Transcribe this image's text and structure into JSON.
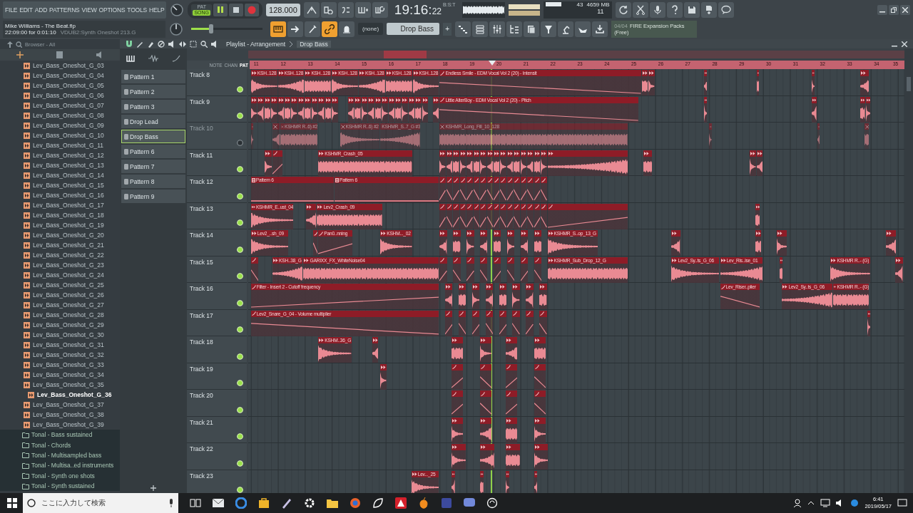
{
  "menu": [
    "FILE",
    "EDIT",
    "ADD",
    "PATTERNS",
    "VIEW",
    "OPTIONS",
    "TOOLS",
    "HELP"
  ],
  "transport": {
    "pat": "PAT",
    "song": "SONG",
    "song_mode": true,
    "playing": true,
    "tempo": "128.000"
  },
  "clock": {
    "main": "19:16:",
    "small": "22",
    "unit": "B:S:T"
  },
  "monitor": {
    "cpu": "43",
    "memory": "4659 MB",
    "polyphony": "11"
  },
  "hint": {
    "title": "Mike Williams - The Beat.flp",
    "detail": "22:09:00 for 0:01:10",
    "sample": "VDUB2:Synth Oneshot 213.G"
  },
  "master_pitch": {
    "level": 0.28
  },
  "tool_toggles": [
    {
      "on": true
    },
    {
      "on": false
    },
    {
      "on": false
    },
    {
      "on": true
    },
    {
      "on": false
    }
  ],
  "pattern_selector": {
    "none": "(none)",
    "current": "Drop Bass",
    "add": "+"
  },
  "news": {
    "count": "04/04",
    "title": "FIRE Expansion Packs",
    "subtitle": "(Free)"
  },
  "browser": {
    "title": "Browser - All",
    "items": [
      {
        "label": "Lev_Bass_Oneshot_G_03",
        "kind": "file",
        "selected": false
      },
      {
        "label": "Lev_Bass_Oneshot_G_04",
        "kind": "file",
        "selected": false
      },
      {
        "label": "Lev_Bass_Oneshot_G_05",
        "kind": "file",
        "selected": false
      },
      {
        "label": "Lev_Bass_Oneshot_G_06",
        "kind": "file",
        "selected": false
      },
      {
        "label": "Lev_Bass_Oneshot_G_07",
        "kind": "file",
        "selected": false
      },
      {
        "label": "Lev_Bass_Oneshot_G_08",
        "kind": "file",
        "selected": false
      },
      {
        "label": "Lev_Bass_Oneshot_G_09",
        "kind": "file",
        "selected": false
      },
      {
        "label": "Lev_Bass_Oneshot_G_10",
        "kind": "file",
        "selected": false
      },
      {
        "label": "Lev_Bass_Oneshot_G_11",
        "kind": "file",
        "selected": false
      },
      {
        "label": "Lev_Bass_Oneshot_G_12",
        "kind": "file",
        "selected": false
      },
      {
        "label": "Lev_Bass_Oneshot_G_13",
        "kind": "file",
        "selected": false
      },
      {
        "label": "Lev_Bass_Oneshot_G_14",
        "kind": "file",
        "selected": false
      },
      {
        "label": "Lev_Bass_Oneshot_G_15",
        "kind": "file",
        "selected": false
      },
      {
        "label": "Lev_Bass_Oneshot_G_16",
        "kind": "file",
        "selected": false
      },
      {
        "label": "Lev_Bass_Oneshot_G_17",
        "kind": "file",
        "selected": false
      },
      {
        "label": "Lev_Bass_Oneshot_G_18",
        "kind": "file",
        "selected": false
      },
      {
        "label": "Lev_Bass_Oneshot_G_19",
        "kind": "file",
        "selected": false
      },
      {
        "label": "Lev_Bass_Oneshot_G_20",
        "kind": "file",
        "selected": false
      },
      {
        "label": "Lev_Bass_Oneshot_G_21",
        "kind": "file",
        "selected": false
      },
      {
        "label": "Lev_Bass_Oneshot_G_22",
        "kind": "file",
        "selected": false
      },
      {
        "label": "Lev_Bass_Oneshot_G_23",
        "kind": "file",
        "selected": false
      },
      {
        "label": "Lev_Bass_Oneshot_G_24",
        "kind": "file",
        "selected": false
      },
      {
        "label": "Lev_Bass_Oneshot_G_25",
        "kind": "file",
        "selected": false
      },
      {
        "label": "Lev_Bass_Oneshot_G_26",
        "kind": "file",
        "selected": false
      },
      {
        "label": "Lev_Bass_Oneshot_G_27",
        "kind": "file",
        "selected": false
      },
      {
        "label": "Lev_Bass_Oneshot_G_28",
        "kind": "file",
        "selected": false
      },
      {
        "label": "Lev_Bass_Oneshot_G_29",
        "kind": "file",
        "selected": false
      },
      {
        "label": "Lev_Bass_Oneshot_G_30",
        "kind": "file",
        "selected": false
      },
      {
        "label": "Lev_Bass_Oneshot_G_31",
        "kind": "file",
        "selected": false
      },
      {
        "label": "Lev_Bass_Oneshot_G_32",
        "kind": "file",
        "selected": false
      },
      {
        "label": "Lev_Bass_Oneshot_G_33",
        "kind": "file",
        "selected": false
      },
      {
        "label": "Lev_Bass_Oneshot_G_34",
        "kind": "file",
        "selected": false
      },
      {
        "label": "Lev_Bass_Oneshot_G_35",
        "kind": "file",
        "selected": false
      },
      {
        "label": "Lev_Bass_Oneshot_G_36",
        "kind": "file",
        "selected": true
      },
      {
        "label": "Lev_Bass_Oneshot_G_37",
        "kind": "file",
        "selected": false
      },
      {
        "label": "Lev_Bass_Oneshot_G_38",
        "kind": "file",
        "selected": false
      },
      {
        "label": "Lev_Bass_Oneshot_G_39",
        "kind": "file",
        "selected": false
      },
      {
        "label": "Tonal - Bass sustained",
        "kind": "folder",
        "selected": false
      },
      {
        "label": "Tonal - Chords",
        "kind": "folder",
        "selected": false
      },
      {
        "label": "Tonal - Multisampled bass",
        "kind": "folder",
        "selected": false
      },
      {
        "label": "Tonal - Multisa..ed instruments",
        "kind": "folder",
        "selected": false
      },
      {
        "label": "Tonal - Synth one shots",
        "kind": "folder",
        "selected": false
      },
      {
        "label": "Tonal - Synth sustained",
        "kind": "folder",
        "selected": false
      }
    ]
  },
  "playlist": {
    "title": "Playlist - Arrangement",
    "breadcrumb": "Drop Bass",
    "patterns": [
      {
        "label": "Pattern 1",
        "selected": false
      },
      {
        "label": "Pattern 2",
        "selected": false
      },
      {
        "label": "Pattern 3",
        "selected": false
      },
      {
        "label": "Drop Lead",
        "selected": false
      },
      {
        "label": "Drop Bass",
        "selected": true
      },
      {
        "label": "Pattern 6",
        "selected": false
      },
      {
        "label": "Pattern 7",
        "selected": false
      },
      {
        "label": "Pattern 8",
        "selected": false
      },
      {
        "label": "Pattern 9",
        "selected": false
      }
    ],
    "ruler_modes": [
      {
        "label": "NOTE",
        "selected": false
      },
      {
        "label": "CHAN",
        "selected": false
      },
      {
        "label": "PAT",
        "selected": true
      }
    ],
    "ruler": [
      "11",
      "12",
      "13",
      "14",
      "15",
      "16",
      "17",
      "18",
      "19",
      "20",
      "21",
      "22",
      "23",
      "24",
      "25",
      "26",
      "27",
      "28",
      "29",
      "30",
      "31",
      "32",
      "33",
      "34",
      "35"
    ],
    "tracks": [
      {
        "name": "Track 8",
        "muted": false,
        "clips": [
          {
            "kind": "audio",
            "label": "KSH..128"
          },
          {
            "kind": "audio",
            "label": "KSH..128"
          },
          {
            "kind": "audio",
            "label": "KSH..128"
          },
          {
            "kind": "audio",
            "label": "KSH..128"
          },
          {
            "kind": "audio",
            "label": "KSH..128"
          },
          {
            "kind": "audio",
            "label": "KSH..128"
          },
          {
            "kind": "audio",
            "label": "KSH..128"
          },
          {
            "kind": "automation",
            "label": "Endless Smile - EDM Vocal Vol 2 (20) - Intensit"
          },
          {
            "kind": "audio"
          },
          {
            "kind": "audio"
          },
          {
            "kind": "audio"
          },
          {
            "kind": "audio"
          },
          {
            "kind": "audio"
          },
          {
            "kind": "audio"
          }
        ]
      },
      {
        "name": "Track 9",
        "muted": false,
        "clips": [
          {
            "kind": "audio"
          },
          {
            "kind": "audio"
          },
          {
            "kind": "audio"
          },
          {
            "kind": "audio"
          },
          {
            "kind": "audio"
          },
          {
            "kind": "audio"
          },
          {
            "kind": "audio"
          },
          {
            "kind": "audio"
          },
          {
            "kind": "audio"
          },
          {
            "kind": "audio"
          },
          {
            "kind": "audio"
          },
          {
            "kind": "audio"
          },
          {
            "kind": "audio"
          },
          {
            "kind": "audio"
          },
          {
            "kind": "audio"
          },
          {
            "kind": "audio"
          },
          {
            "kind": "audio"
          },
          {
            "kind": "audio"
          },
          {
            "kind": "audio"
          },
          {
            "kind": "audio"
          },
          {
            "kind": "audio"
          },
          {
            "kind": "audio"
          },
          {
            "kind": "audio"
          },
          {
            "kind": "audio"
          },
          {
            "kind": "audio"
          },
          {
            "kind": "audio"
          },
          {
            "kind": "automation",
            "label": "Little AlterBoy - EDM Vocal Vol 2 (20) - Pitch"
          },
          {
            "kind": "audio"
          },
          {
            "kind": "audio"
          },
          {
            "kind": "audio"
          },
          {
            "kind": "audio"
          }
        ]
      },
      {
        "name": "Track 10",
        "muted": true,
        "clips": [
          {
            "kind": "sliced"
          },
          {
            "kind": "sliced"
          },
          {
            "kind": "sliced",
            "label": "KSHMR R..6) #2"
          },
          {
            "kind": "sliced",
            "label": "KSHMR R..6) #2"
          },
          {
            "kind": "sliced",
            "label": "KSHMR_S..7_G #3"
          },
          {
            "kind": "sliced",
            "label": "KSHMR_Long_Fill_10_128"
          },
          {
            "kind": "sliced"
          },
          {
            "kind": "sliced"
          },
          {
            "kind": "sliced"
          }
        ]
      },
      {
        "name": "Track 11",
        "muted": false,
        "clips": [
          {
            "kind": "audio"
          },
          {
            "kind": "automation"
          },
          {
            "kind": "audio",
            "label": "KSHMR_Crash_05"
          },
          {
            "kind": "audio"
          },
          {
            "kind": "audio"
          },
          {
            "kind": "audio"
          },
          {
            "kind": "audio"
          },
          {
            "kind": "audio"
          },
          {
            "kind": "audio"
          },
          {
            "kind": "audio"
          },
          {
            "kind": "audio"
          },
          {
            "kind": "audio"
          },
          {
            "kind": "audio"
          },
          {
            "kind": "audio"
          },
          {
            "kind": "audio"
          },
          {
            "kind": "audio"
          },
          {
            "kind": "audio"
          },
          {
            "kind": "audio"
          },
          {
            "kind": "audio"
          },
          {
            "kind": "audio"
          },
          {
            "kind": "audio"
          },
          {
            "kind": "audio"
          },
          {
            "kind": "audio"
          }
        ]
      },
      {
        "name": "Track 12",
        "muted": false,
        "clips": [
          {
            "kind": "pattern",
            "label": "Pattern 6"
          },
          {
            "kind": "pattern",
            "label": "Pattern 6"
          },
          {
            "kind": "automation"
          },
          {
            "kind": "automation"
          },
          {
            "kind": "automation"
          },
          {
            "kind": "automation"
          },
          {
            "kind": "automation"
          },
          {
            "kind": "automation"
          },
          {
            "kind": "automation"
          },
          {
            "kind": "automation"
          },
          {
            "kind": "automation"
          },
          {
            "kind": "automation"
          },
          {
            "kind": "automation"
          },
          {
            "kind": "automation"
          },
          {
            "kind": "automation"
          },
          {
            "kind": "automation"
          },
          {
            "kind": "automation"
          },
          {
            "kind": "automation"
          }
        ]
      },
      {
        "name": "Track 13",
        "muted": false,
        "clips": [
          {
            "kind": "audio",
            "label": "KSHMR_E..ust_04"
          },
          {
            "kind": "audio"
          },
          {
            "kind": "audio",
            "label": "Lev2_Crash_09"
          },
          {
            "kind": "automation"
          },
          {
            "kind": "automation"
          },
          {
            "kind": "automation"
          },
          {
            "kind": "automation"
          },
          {
            "kind": "automation"
          },
          {
            "kind": "automation"
          },
          {
            "kind": "automation"
          },
          {
            "kind": "automation"
          },
          {
            "kind": "automation"
          },
          {
            "kind": "automation"
          },
          {
            "kind": "automation"
          },
          {
            "kind": "automation"
          },
          {
            "kind": "automation"
          },
          {
            "kind": "automation"
          },
          {
            "kind": "automation"
          },
          {
            "kind": "automation"
          },
          {
            "kind": "automation"
          },
          {
            "kind": "audio"
          }
        ]
      },
      {
        "name": "Track 14",
        "muted": false,
        "clips": [
          {
            "kind": "audio",
            "label": "Lev2_..sh_09"
          },
          {
            "kind": "automation"
          },
          {
            "kind": "automation",
            "label": "Pan0..nning"
          },
          {
            "kind": "audio",
            "label": "KSHM..._02"
          },
          {
            "kind": "audio"
          },
          {
            "kind": "audio"
          },
          {
            "kind": "audio"
          },
          {
            "kind": "audio"
          },
          {
            "kind": "audio"
          },
          {
            "kind": "audio"
          },
          {
            "kind": "audio"
          },
          {
            "kind": "audio"
          },
          {
            "kind": "audio",
            "label": "KSHMR_S..op_13_G"
          },
          {
            "kind": "audio"
          },
          {
            "kind": "audio"
          },
          {
            "kind": "audio"
          },
          {
            "kind": "audio"
          }
        ]
      },
      {
        "name": "Track 15",
        "muted": false,
        "clips": [
          {
            "kind": "automation"
          },
          {
            "kind": "audio",
            "label": "KSH..38_G"
          },
          {
            "kind": "audio",
            "label": "GARIXX_FX_WhiteNoise04"
          },
          {
            "kind": "automation"
          },
          {
            "kind": "automation"
          },
          {
            "kind": "automation"
          },
          {
            "kind": "automation"
          },
          {
            "kind": "automation"
          },
          {
            "kind": "automation"
          },
          {
            "kind": "automation"
          },
          {
            "kind": "automation"
          },
          {
            "kind": "audio",
            "label": "KSHMR_Sub_Drop_12_G"
          },
          {
            "kind": "audio",
            "label": "Lev2_Sy..ts_G_06"
          },
          {
            "kind": "audio",
            "label": "Lev_Ris..ise_01"
          },
          {
            "kind": "audio"
          },
          {
            "kind": "audio",
            "label": "KSHMR R..- (G)"
          },
          {
            "kind": "audio"
          }
        ]
      },
      {
        "name": "Track 16",
        "muted": false,
        "clips": [
          {
            "kind": "automation",
            "label": "Filter - Insert 2 - Cutoff frequency"
          },
          {
            "kind": "audio"
          },
          {
            "kind": "audio"
          },
          {
            "kind": "audio"
          },
          {
            "kind": "audio"
          },
          {
            "kind": "audio"
          },
          {
            "kind": "audio"
          },
          {
            "kind": "audio"
          },
          {
            "kind": "audio"
          },
          {
            "kind": "automation",
            "label": "Lev_Riser..plier"
          },
          {
            "kind": "audio",
            "label": "Lev2_Sy..ts_G_06"
          },
          {
            "kind": "audio",
            "label": "KSHMR R..- (G)"
          }
        ]
      },
      {
        "name": "Track 17",
        "muted": false,
        "clips": [
          {
            "kind": "automation",
            "label": "Lev2_Snare_G_04 - Volume multiplier"
          },
          {
            "kind": "automation"
          },
          {
            "kind": "automation"
          },
          {
            "kind": "automation"
          },
          {
            "kind": "automation"
          },
          {
            "kind": "automation"
          },
          {
            "kind": "automation"
          },
          {
            "kind": "automation"
          },
          {
            "kind": "automation"
          },
          {
            "kind": "audio"
          }
        ]
      },
      {
        "name": "Track 18",
        "muted": false,
        "clips": [
          {
            "kind": "audio",
            "label": "KSHM..36_G"
          },
          {
            "kind": "audio"
          },
          {
            "kind": "audio"
          },
          {
            "kind": "audio"
          },
          {
            "kind": "audio"
          },
          {
            "kind": "audio"
          }
        ]
      },
      {
        "name": "Track 19",
        "muted": false,
        "clips": [
          {
            "kind": "audio"
          },
          {
            "kind": "automation"
          },
          {
            "kind": "automation"
          },
          {
            "kind": "automation"
          },
          {
            "kind": "automation"
          }
        ]
      },
      {
        "name": "Track 20",
        "muted": false,
        "clips": [
          {
            "kind": "automation"
          },
          {
            "kind": "automation"
          },
          {
            "kind": "automation"
          },
          {
            "kind": "automation"
          }
        ]
      },
      {
        "name": "Track 21",
        "muted": false,
        "clips": [
          {
            "kind": "audio"
          },
          {
            "kind": "audio"
          },
          {
            "kind": "audio"
          },
          {
            "kind": "audio"
          }
        ]
      },
      {
        "name": "Track 22",
        "muted": false,
        "clips": [
          {
            "kind": "audio"
          },
          {
            "kind": "audio"
          },
          {
            "kind": "audio"
          },
          {
            "kind": "audio"
          }
        ]
      },
      {
        "name": "Track 23",
        "muted": false,
        "clips": [
          {
            "kind": "audio",
            "label": "Lev..._25"
          },
          {
            "kind": "audio"
          },
          {
            "kind": "audio"
          },
          {
            "kind": "audio"
          },
          {
            "kind": "audio"
          }
        ]
      }
    ]
  },
  "taskbar": {
    "search": "ここに入力して検索",
    "time": "6:41",
    "date": "2019/05/17"
  }
}
